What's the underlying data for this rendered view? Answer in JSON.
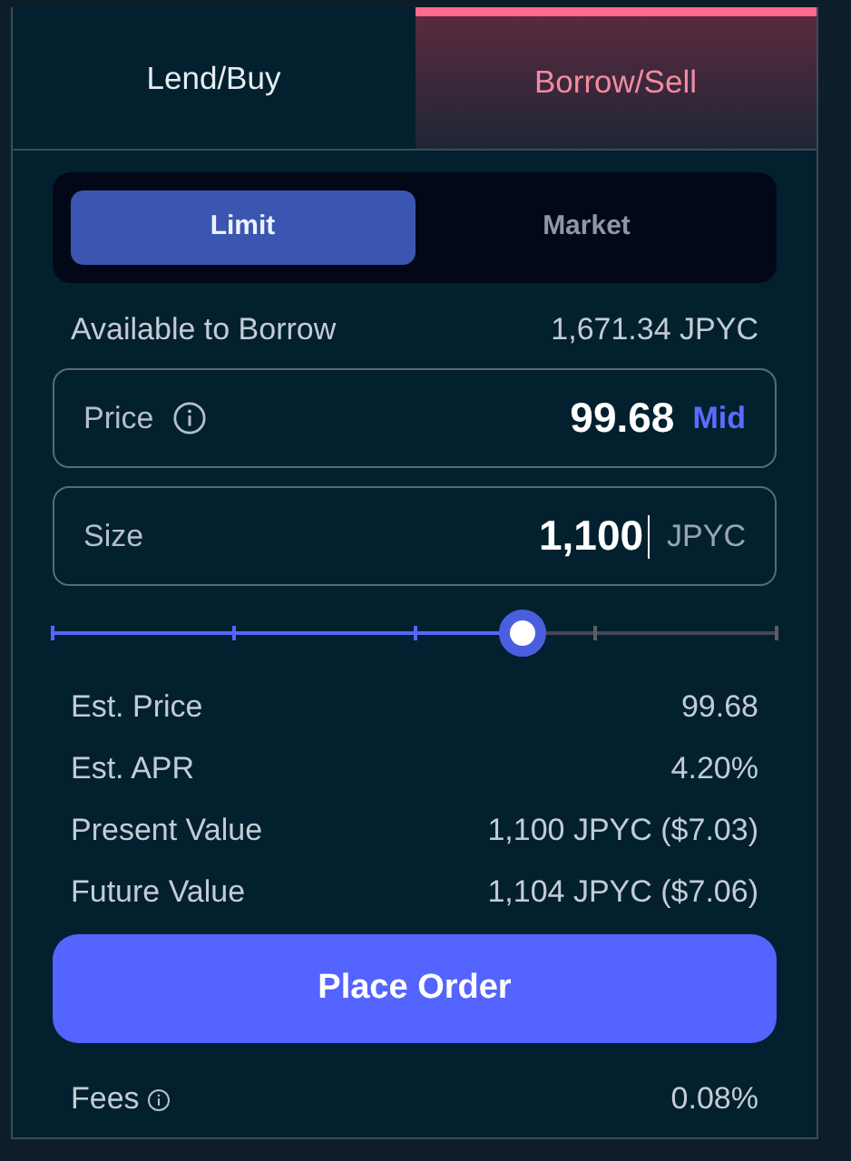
{
  "tabs": [
    {
      "label": "Lend/Buy",
      "selected": false
    },
    {
      "label": "Borrow/Sell",
      "selected": true
    }
  ],
  "order_types": [
    {
      "label": "Limit",
      "selected": true
    },
    {
      "label": "Market",
      "selected": false
    }
  ],
  "available": {
    "label": "Available to Borrow",
    "value": "1,671.34 JPYC"
  },
  "price_field": {
    "label": "Price",
    "value": "99.68",
    "action": "Mid"
  },
  "size_field": {
    "label": "Size",
    "value": "1,100",
    "unit": "JPYC"
  },
  "size_slider": {
    "level": 0.65
  },
  "summary": [
    {
      "label": "Est. Price",
      "value": "99.68"
    },
    {
      "label": "Est. APR",
      "value": "4.20%"
    },
    {
      "label": "Present Value",
      "value": "1,100 JPYC ($7.03)"
    },
    {
      "label": "Future Value",
      "value": "1,104 JPYC ($7.06)"
    }
  ],
  "submit_button": "Place Order",
  "fees": {
    "label": "Fees",
    "value": "0.08%"
  }
}
